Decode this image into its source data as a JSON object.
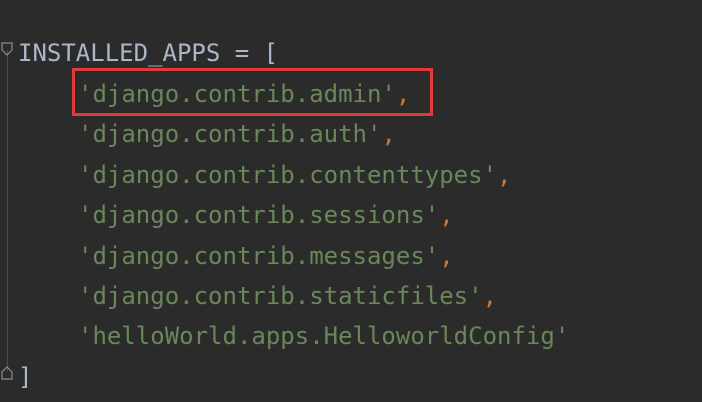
{
  "editor": {
    "declaration": {
      "name": "INSTALLED_APPS",
      "operator": " = ",
      "open_bracket": "["
    },
    "items": [
      {
        "value": "'django.contrib.admin'",
        "separator": ","
      },
      {
        "value": "'django.contrib.auth'",
        "separator": ","
      },
      {
        "value": "'django.contrib.contenttypes'",
        "separator": ","
      },
      {
        "value": "'django.contrib.sessions'",
        "separator": ","
      },
      {
        "value": "'django.contrib.messages'",
        "separator": ","
      },
      {
        "value": "'django.contrib.staticfiles'",
        "separator": ","
      },
      {
        "value": "'helloWorld.apps.HelloworldConfig'",
        "separator": ""
      }
    ],
    "close_bracket": "]"
  },
  "colors": {
    "background": "#2b2b2b",
    "identifier": "#a9b7c6",
    "string": "#6a8759",
    "punctuation": "#cc7832",
    "highlight_border": "#e03a3a"
  },
  "icons": {
    "fold_top": "fold-open-icon",
    "fold_bottom": "fold-close-icon"
  }
}
